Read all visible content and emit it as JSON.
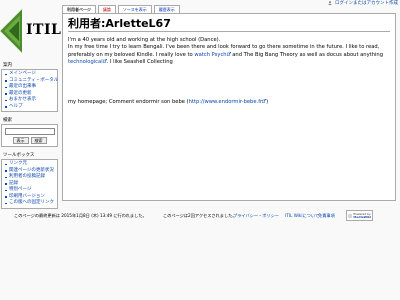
{
  "personal": {
    "login_label": "ログインまたはアカウント作成"
  },
  "logo": {
    "text": "ITIL"
  },
  "tabs": [
    {
      "label": "利用者ページ"
    },
    {
      "label": "議論"
    },
    {
      "label": "ソースを表示"
    },
    {
      "label": "履歴表示"
    }
  ],
  "content": {
    "heading": "利用者:ArletteL67",
    "p1_text1": "I'm a 40 years old and working at the high school (Dance).",
    "p1_text2": "In my free time I try to learn Bengali. I've been there and look forward to go there sometime in the future. I like to read, preferably on my beloved Kindle. I really love to ",
    "p1_link1": "watch Psych",
    "p1_text3": " and The Big Bang Theory as well as docus about anything ",
    "p1_link2": "technological",
    "p1_text4": ". I like Seashell Collecting",
    "p2_text1": "my homepage; Comment endormir son bebe (",
    "p2_link": "http://www.endormir-bebe.fr",
    "p2_text2": ")"
  },
  "sidebar": {
    "nav_title": "案内",
    "nav_items": [
      {
        "label": "メインページ"
      },
      {
        "label": "コミュニティ・ポータル"
      },
      {
        "label": "最近の出来事"
      },
      {
        "label": "最近の更新"
      },
      {
        "label": "おまかせ表示"
      },
      {
        "label": "ヘルプ"
      }
    ],
    "search_title": "検索",
    "search_go": "表示",
    "search_btn": "検索",
    "tools_title": "ツールボックス",
    "tools_items": [
      {
        "label": "リンク元"
      },
      {
        "label": "関連ページの更新状況"
      },
      {
        "label": "利用者の投稿記録"
      },
      {
        "label": "記録"
      },
      {
        "label": "特別ページ"
      },
      {
        "label": "印刷用バージョン"
      },
      {
        "label": "この版への固定リンク"
      }
    ]
  },
  "footer": {
    "last_modified": "このページの最終更新は 2015年1月8日 (木) 13:49 に行われました。",
    "views": "このページは2回アクセスされました。",
    "privacy": "プライバシー・ポリシー",
    "about": "ITIL Wikiについて",
    "disclaimer": "免責事項",
    "powered_by": "Powered by",
    "mediawiki": "MediaWiki"
  }
}
